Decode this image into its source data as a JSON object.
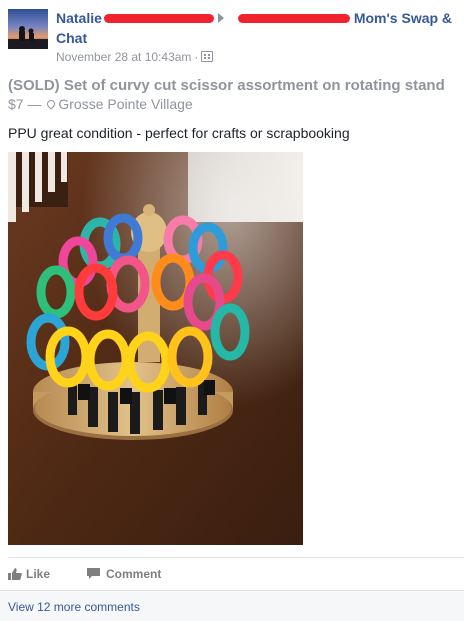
{
  "post": {
    "author_first": "Natalie",
    "group_name_suffix": "Mom's Swap &",
    "group_name_line2": "Chat",
    "timestamp": "November 28 at 10:43am",
    "dot": "·",
    "audience_icon": "group-audience-icon"
  },
  "listing": {
    "title": "(SOLD) Set of curvy cut scissor assortment on rotating stand",
    "price": "$7",
    "dash": "—",
    "location": "Grosse Pointe Village"
  },
  "description": "PPU great condition - perfect for crafts or scrapbooking",
  "actions": {
    "like_label": "Like",
    "comment_label": "Comment"
  },
  "comments": {
    "more_label": "View 12 more comments"
  },
  "colors": {
    "link_blue": "#365899",
    "muted_gray": "#90949c",
    "redaction_red": "#f0242f",
    "comments_bg": "#f6f7f9"
  }
}
